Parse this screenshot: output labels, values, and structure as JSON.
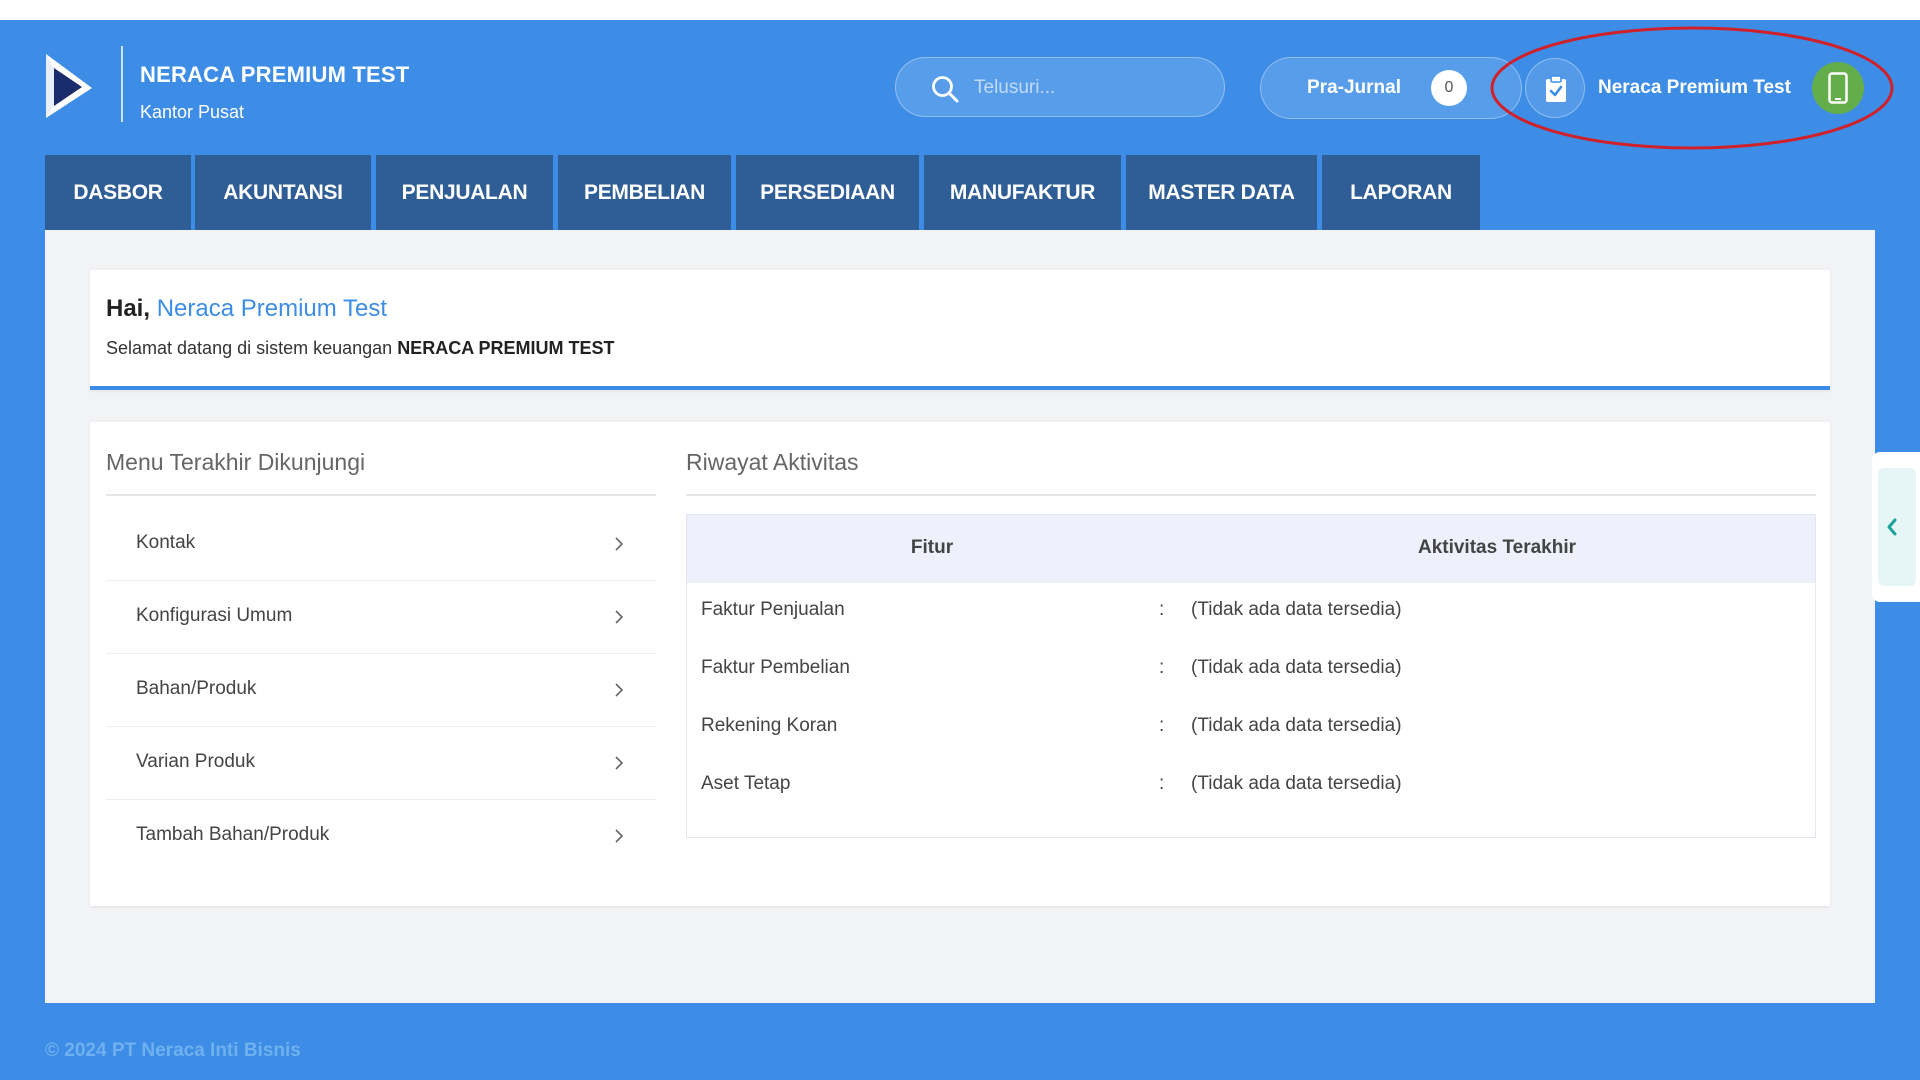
{
  "brand": {
    "company_name": "NERACA PREMIUM TEST",
    "branch": "Kantor Pusat",
    "logo_icon": "neraca-play-logo"
  },
  "header": {
    "search_placeholder": "Telusuri...",
    "pra_jurnal_label": "Pra-Jurnal",
    "pra_jurnal_count": "0",
    "user_name": "Neraca Premium Test",
    "clipboard_icon": "clipboard-check-icon",
    "avatar_icon": "mobile-phone-icon"
  },
  "nav": {
    "tabs": [
      {
        "label": "DASBOR"
      },
      {
        "label": "AKUNTANSI"
      },
      {
        "label": "PENJUALAN"
      },
      {
        "label": "PEMBELIAN"
      },
      {
        "label": "PERSEDIAAN"
      },
      {
        "label": "MANUFAKTUR"
      },
      {
        "label": "MASTER DATA"
      },
      {
        "label": "LAPORAN"
      }
    ]
  },
  "welcome": {
    "greeting_prefix": "Hai, ",
    "greeting_name": "Neraca Premium Test",
    "message": "Selamat datang di sistem keuangan ",
    "company": "NERACA PREMIUM TEST"
  },
  "recent_menu": {
    "title": "Menu Terakhir Dikunjungi",
    "items": [
      {
        "label": "Kontak"
      },
      {
        "label": "Konfigurasi Umum"
      },
      {
        "label": "Bahan/Produk"
      },
      {
        "label": "Varian Produk"
      },
      {
        "label": "Tambah Bahan/Produk"
      }
    ]
  },
  "activity": {
    "title": "Riwayat Aktivitas",
    "columns": [
      "Fitur",
      "Aktivitas Terakhir"
    ],
    "separator": ":",
    "rows": [
      {
        "feature": "Faktur Penjualan",
        "value": "(Tidak ada data tersedia)"
      },
      {
        "feature": "Faktur Pembelian",
        "value": "(Tidak ada data tersedia)"
      },
      {
        "feature": "Rekening Koran",
        "value": "(Tidak ada data tersedia)"
      },
      {
        "feature": "Aset Tetap",
        "value": "(Tidak ada data tersedia)"
      }
    ]
  },
  "footer": {
    "text": "© 2024 PT Neraca Inti Bisnis"
  },
  "colors": {
    "primary": "#3d8de6",
    "nav_tab": "#2f5d95",
    "avatar": "#63ad4a",
    "annotation": "#d0202a"
  }
}
